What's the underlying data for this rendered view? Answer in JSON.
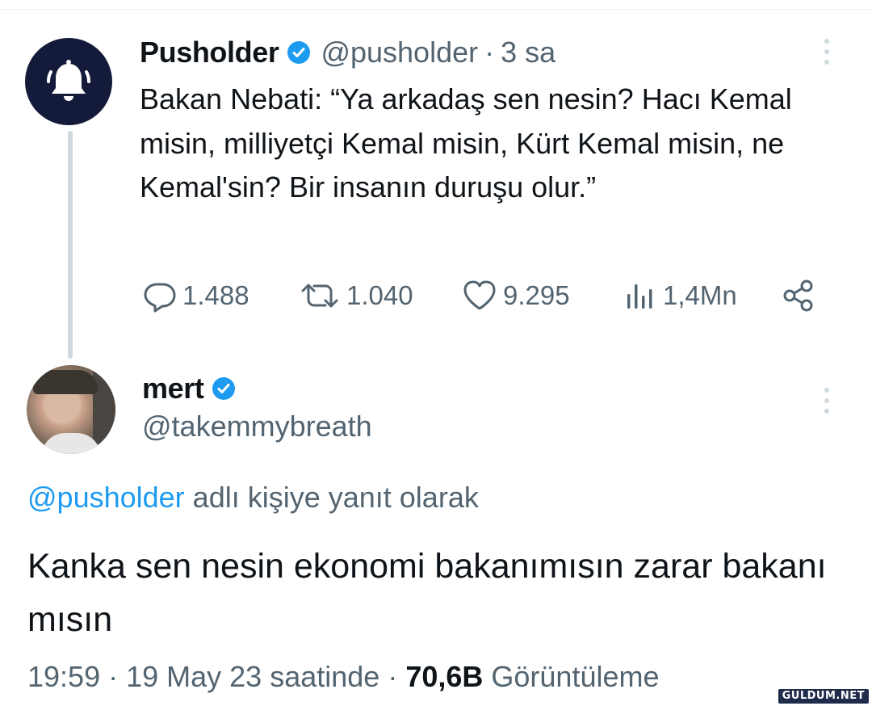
{
  "parent_tweet": {
    "author_name": "Pusholder",
    "handle": "@pusholder",
    "separator": "·",
    "time": "3 sa",
    "text": "Bakan Nebati: “Ya arkadaş sen nesin? Hacı Kemal misin, milliyetçi Kemal misin, Kürt Kemal misin, ne Kemal'sin? Bir insanın duruşu olur.”",
    "stats": {
      "replies": "1.488",
      "reposts": "1.040",
      "likes": "9.295",
      "views": "1,4Mn"
    }
  },
  "reply_tweet": {
    "author_name": "mert",
    "handle": "@takemmybreath",
    "reply_context_mention": "@pusholder",
    "reply_context_text": " adlı kişiye yanıt olarak",
    "text": "Kanka sen nesin ekonomi bakanımısın zarar bakanı mısın",
    "time": "19:59",
    "separator": " · ",
    "date": "19 May 23 saatinde",
    "views_count": "70,6B",
    "views_label": " Görüntüleme"
  },
  "watermark": "GULDUM.NET",
  "colors": {
    "text": "#0f1419",
    "secondary": "#536471",
    "accent": "#1d9bf0",
    "thread_line": "#cfd9de",
    "brand_avatar_bg": "#141b3a"
  },
  "icons": [
    "bell-icon",
    "verified-badge-icon",
    "more-icon",
    "reply-icon",
    "repost-icon",
    "like-icon",
    "views-icon",
    "share-icon"
  ]
}
